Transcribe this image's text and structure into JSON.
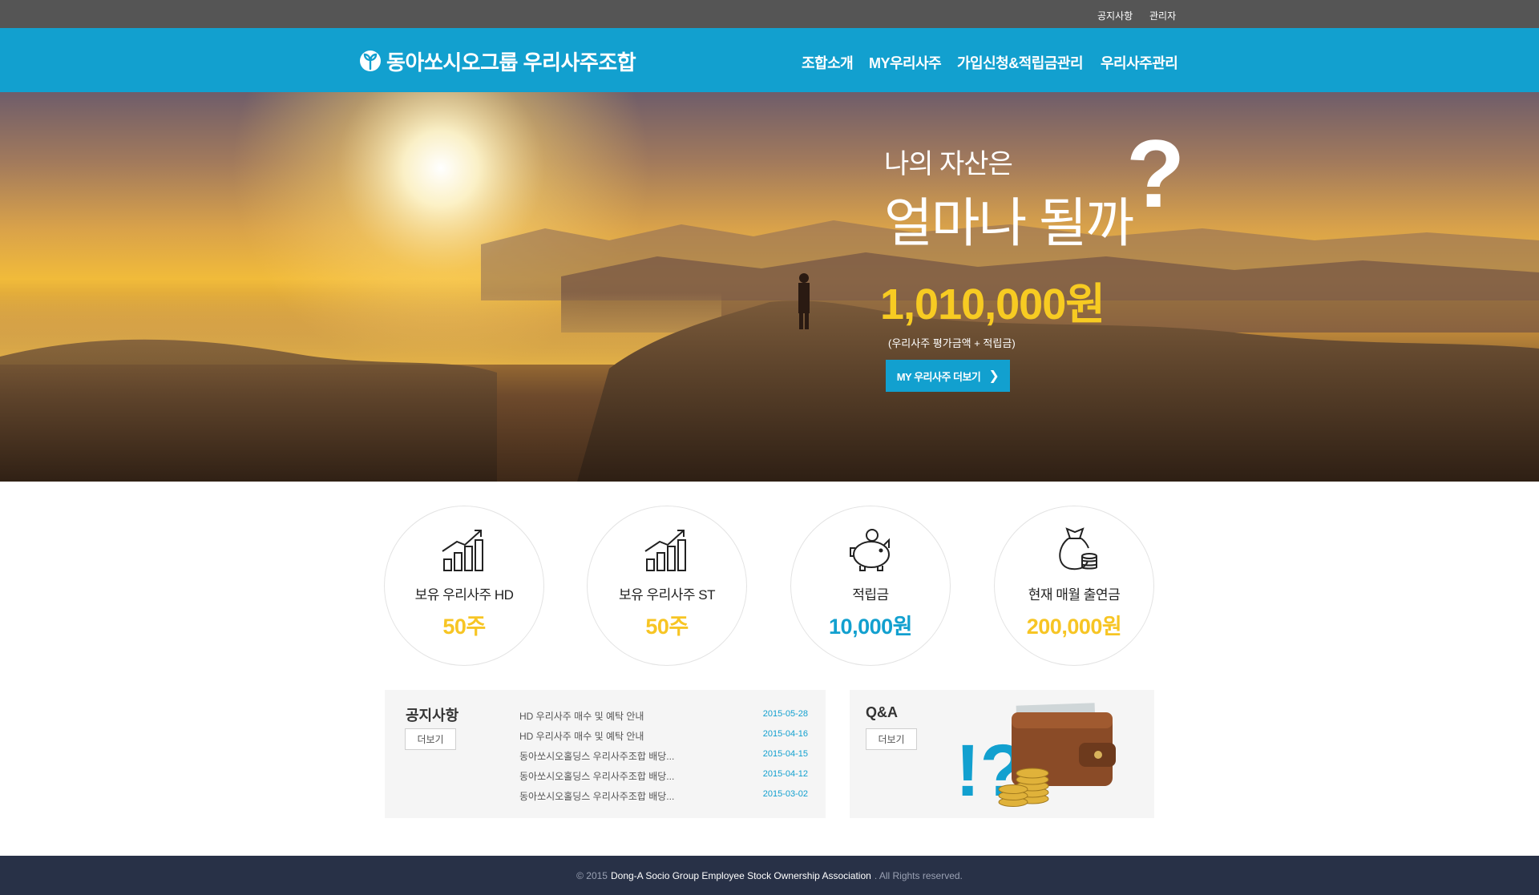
{
  "topbar": {
    "links": [
      "공지사항",
      "관리자"
    ]
  },
  "header": {
    "logo_text": "동아쏘시오그룹 우리사주조합",
    "nav": [
      "조합소개",
      "MY우리사주",
      "가입신청&적립금관리",
      "우리사주관리"
    ],
    "color": "#12a0cf"
  },
  "hero": {
    "line1": "나의 자산은",
    "line2": "얼마나 될까",
    "question_mark": "?",
    "amount": "1,010,000원",
    "note": "(우리사주 평가금액 + 적립금)",
    "button_label": "MY 우리사주 더보기"
  },
  "stats": [
    {
      "icon": "growth-chart-icon",
      "label": "보유 우리사주 HD",
      "value": "50주",
      "color": "#f7c524"
    },
    {
      "icon": "growth-chart-icon",
      "label": "보유 우리사주 ST",
      "value": "50주",
      "color": "#f7c524"
    },
    {
      "icon": "piggy-bank-icon",
      "label": "적립금",
      "value": "10,000원",
      "color": "#12a0cf"
    },
    {
      "icon": "money-bag-icon",
      "label": "현재 매월 출연금",
      "value": "200,000원",
      "color": "#f7c524"
    }
  ],
  "notice": {
    "title": "공지사항",
    "more_label": "더보기",
    "items": [
      {
        "title": "HD 우리사주 매수 및 예탁 안내",
        "date": "2015-05-28"
      },
      {
        "title": "HD 우리사주 매수 및 예탁 안내",
        "date": "2015-04-16"
      },
      {
        "title": "동아쏘시오홀딩스 우리사주조합 배당...",
        "date": "2015-04-15"
      },
      {
        "title": "동아쏘시오홀딩스 우리사주조합 배당...",
        "date": "2015-04-12"
      },
      {
        "title": "동아쏘시오홀딩스 우리사주조합 배당...",
        "date": "2015-03-02"
      }
    ]
  },
  "qna": {
    "title": "Q&A",
    "more_label": "더보기",
    "graphic_text": "!?"
  },
  "footer": {
    "prefix": "© 2015",
    "org": "Dong-A Socio Group Employee Stock Ownership Association",
    "suffix": ". All Rights reserved."
  }
}
